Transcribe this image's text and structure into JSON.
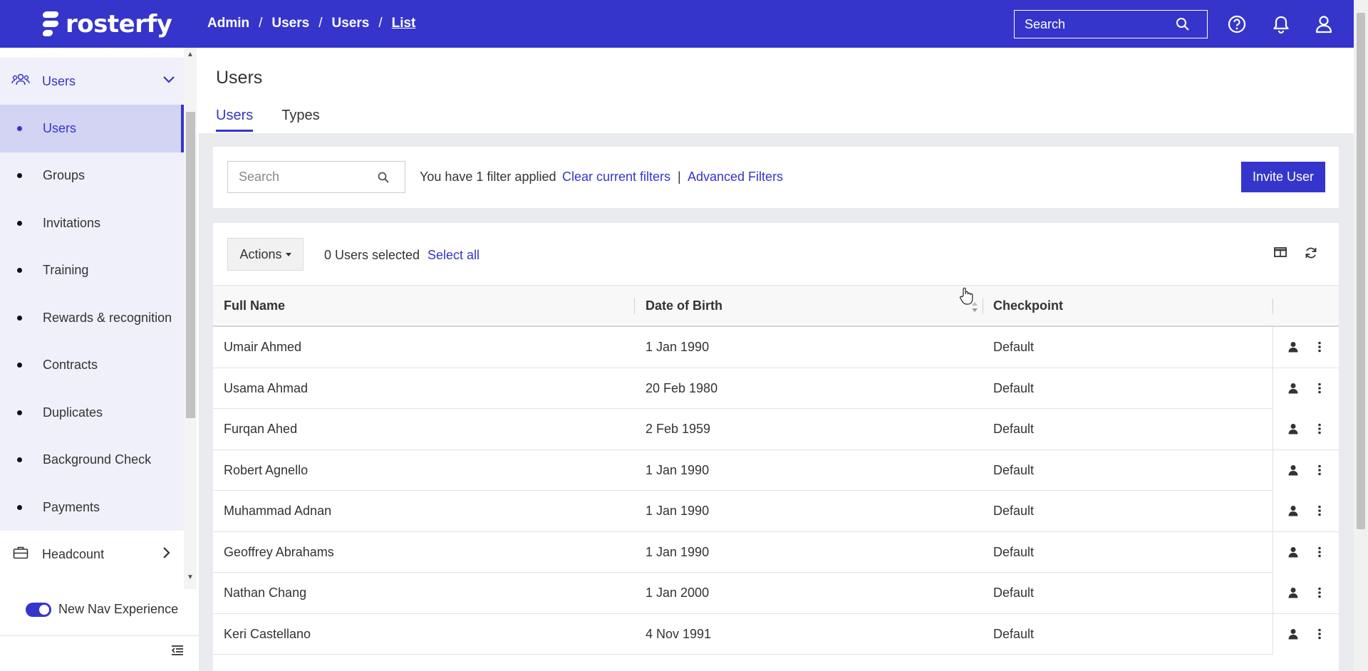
{
  "app": {
    "logo_text": "rosterfy"
  },
  "breadcrumb": {
    "items": [
      "Admin",
      "Users",
      "Users"
    ],
    "current": "List"
  },
  "topbar": {
    "search_placeholder": "Search"
  },
  "sidebar": {
    "group_label": "Users",
    "items": [
      {
        "label": "Users",
        "active": true
      },
      {
        "label": "Groups"
      },
      {
        "label": "Invitations"
      },
      {
        "label": "Training"
      },
      {
        "label": "Rewards & recognition"
      },
      {
        "label": "Contracts"
      },
      {
        "label": "Duplicates"
      },
      {
        "label": "Background Check"
      },
      {
        "label": "Payments"
      }
    ],
    "headcount_label": "Headcount",
    "toggle_label": "New Nav Experience"
  },
  "page": {
    "title": "Users",
    "tabs": [
      "Users",
      "Types"
    ]
  },
  "filters": {
    "search_placeholder": "Search",
    "status_text": "You have 1 filter applied",
    "clear_link": "Clear current filters",
    "separator": "|",
    "advanced_link": "Advanced Filters",
    "invite_button": "Invite User"
  },
  "table": {
    "actions_label": "Actions",
    "selected_text": "0 Users selected",
    "select_all": "Select all",
    "columns": [
      "Full Name",
      "Date of Birth",
      "Checkpoint"
    ],
    "rows": [
      [
        "Umair Ahmed",
        "1 Jan 1990",
        "Default"
      ],
      [
        "Usama Ahmad",
        "20 Feb 1980",
        "Default"
      ],
      [
        "Furqan Ahed",
        "2 Feb 1959",
        "Default"
      ],
      [
        "Robert Agnello",
        "1 Jan 1990",
        "Default"
      ],
      [
        "Muhammad Adnan",
        "1 Jan 1990",
        "Default"
      ],
      [
        "Geoffrey Abrahams",
        "1 Jan 1990",
        "Default"
      ],
      [
        "Nathan Chang",
        "1 Jan 2000",
        "Default"
      ],
      [
        "Keri Castellano",
        "4 Nov 1991",
        "Default"
      ]
    ]
  },
  "colors": {
    "brand": "#3535cc",
    "sidebar_bg": "#f0f0fa",
    "sidebar_active": "#d3d3f4"
  }
}
